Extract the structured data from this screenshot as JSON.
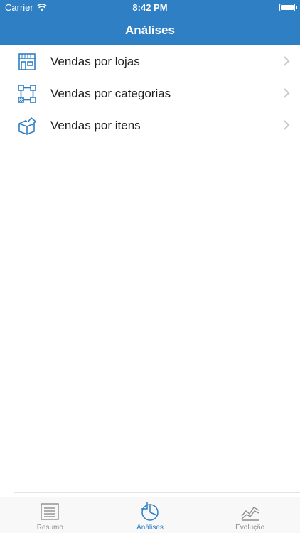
{
  "status_bar": {
    "carrier": "Carrier",
    "time": "8:42 PM",
    "battery_level": 1.0
  },
  "nav": {
    "title": "Análises"
  },
  "list": {
    "items": [
      {
        "label": "Vendas por lojas",
        "icon": "store-icon"
      },
      {
        "label": "Vendas por categorias",
        "icon": "categories-icon"
      },
      {
        "label": "Vendas por itens",
        "icon": "box-icon"
      }
    ]
  },
  "tabbar": {
    "tabs": [
      {
        "label": "Resumo",
        "icon": "document-icon",
        "active": false
      },
      {
        "label": "Análises",
        "icon": "pie-chart-icon",
        "active": true
      },
      {
        "label": "Evolução",
        "icon": "trend-chart-icon",
        "active": false
      }
    ]
  },
  "colors": {
    "brand": "#2f7fc4",
    "tab_inactive": "#8e8e8e",
    "separator": "#dcdcdc"
  }
}
